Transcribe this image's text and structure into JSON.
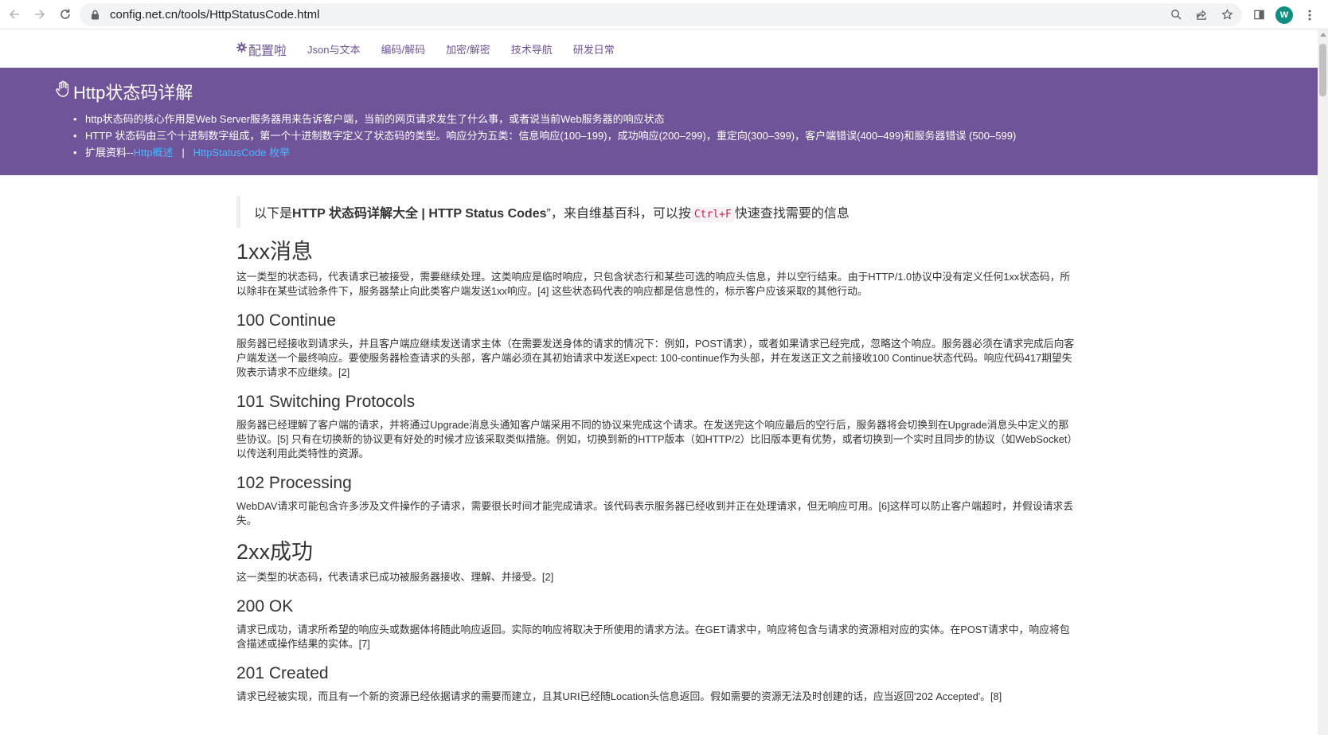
{
  "browser": {
    "url": "config.net.cn/tools/HttpStatusCode.html",
    "avatar_letter": "W"
  },
  "site": {
    "brand": "配置啦",
    "nav": [
      "Json与文本",
      "编码/解码",
      "加密/解密",
      "技术导航",
      "研发日常"
    ]
  },
  "hero": {
    "title": "Http状态码详解",
    "bullet1": "http状态码的核心作用是Web Server服务器用来告诉客户端，当前的网页请求发生了什么事，或者说当前Web服务器的响应状态",
    "bullet2": "HTTP 状态码由三个十进制数字组成，第一个十进制数字定义了状态码的类型。响应分为五类：信息响应(100–199)，成功响应(200–299)，重定向(300–399)，客户端错误(400–499)和服务器错误 (500–599)",
    "bullet3_prefix": "扩展资料--",
    "link1": "Http概述",
    "separator": "|",
    "link2": "HttpStatusCode 枚举"
  },
  "intro": {
    "prefix": "以下是",
    "bold": "HTTP 状态码详解大全 | HTTP Status Codes",
    "middle": "”，来自维基百科，可以按",
    "code": "Ctrl+F",
    "suffix": "快速查找需要的信息"
  },
  "sections": [
    {
      "type": "section",
      "title": "1xx消息",
      "text": "这一类型的状态码，代表请求已被接受，需要继续处理。这类响应是临时响应，只包含状态行和某些可选的响应头信息，并以空行结束。由于HTTP/1.0协议中没有定义任何1xx状态码，所以除非在某些试验条件下，服务器禁止向此类客户端发送1xx响应。[4] 这些状态码代表的响应都是信息性的，标示客户应该采取的其他行动。"
    },
    {
      "type": "item",
      "title": "100 Continue",
      "text": "服务器已经接收到请求头，并且客户端应继续发送请求主体（在需要发送身体的请求的情况下：例如，POST请求），或者如果请求已经完成，忽略这个响应。服务器必须在请求完成后向客户端发送一个最终响应。要使服务器检查请求的头部，客户端必须在其初始请求中发送Expect: 100-continue作为头部，并在发送正文之前接收100 Continue状态代码。响应代码417期望失败表示请求不应继续。[2]"
    },
    {
      "type": "item",
      "title": "101 Switching Protocols",
      "text": "服务器已经理解了客户端的请求，并将通过Upgrade消息头通知客户端采用不同的协议来完成这个请求。在发送完这个响应最后的空行后，服务器将会切换到在Upgrade消息头中定义的那些协议。[5] 只有在切换新的协议更有好处的时候才应该采取类似措施。例如，切换到新的HTTP版本（如HTTP/2）比旧版本更有优势，或者切换到一个实时且同步的协议（如WebSocket）以传送利用此类特性的资源。"
    },
    {
      "type": "item",
      "title": "102 Processing",
      "text": "WebDAV请求可能包含许多涉及文件操作的子请求，需要很长时间才能完成请求。该代码表示服务器已经收到并正在处理请求，但无响应可用。[6]这样可以防止客户端超时，并假设请求丢失。"
    },
    {
      "type": "section",
      "title": "2xx成功",
      "text": "这一类型的状态码，代表请求已成功被服务器接收、理解、并接受。[2]"
    },
    {
      "type": "item",
      "title": "200 OK",
      "text": "请求已成功，请求所希望的响应头或数据体将随此响应返回。实际的响应将取决于所使用的请求方法。在GET请求中，响应将包含与请求的资源相对应的实体。在POST请求中，响应将包含描述或操作结果的实体。[7]"
    },
    {
      "type": "item",
      "title": "201 Created",
      "text": "请求已经被实现，而且有一个新的资源已经依据请求的需要而建立，且其URI已经随Location头信息返回。假如需要的资源无法及时创建的话，应当返回'202 Accepted'。[8]"
    }
  ]
}
